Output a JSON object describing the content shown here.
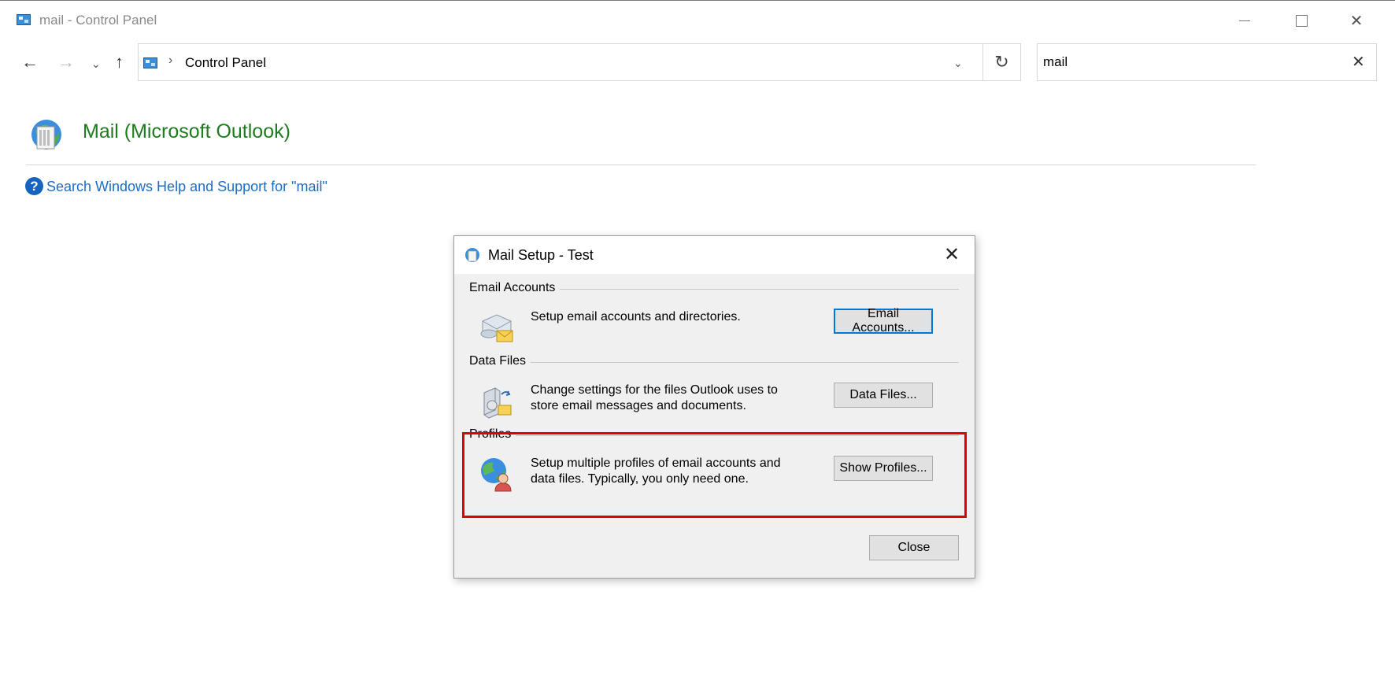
{
  "window": {
    "title": "mail - Control Panel",
    "min_icon": "minimize-icon",
    "max_icon": "maximize-icon",
    "close_icon": "close-icon",
    "close_glyph": "✕"
  },
  "nav": {
    "back_glyph": "←",
    "forward_glyph": "→",
    "recent_glyph": "⌄",
    "up_glyph": "↑",
    "separator": "›",
    "dropdown_glyph": "⌄",
    "refresh_glyph": "↻"
  },
  "address": {
    "breadcrumb": "Control Panel"
  },
  "search": {
    "value": "mail",
    "clear_glyph": "✕"
  },
  "result": {
    "title": "Mail (Microsoft Outlook)",
    "help_glyph": "?",
    "help_link": "Search Windows Help and Support for \"mail\""
  },
  "dialog": {
    "title": "Mail Setup - Test",
    "close_glyph": "✕",
    "sections": [
      {
        "label": "Email Accounts",
        "description_line1": "Setup email accounts and directories.",
        "description_line2": "",
        "button": "Email Accounts..."
      },
      {
        "label": "Data Files",
        "description_line1": "Change settings for the files Outlook uses to",
        "description_line2": "store email messages and documents.",
        "button": "Data Files..."
      },
      {
        "label": "Profiles",
        "description_line1": "Setup multiple profiles of email accounts and",
        "description_line2": "data files. Typically, you only need one.",
        "button": "Show Profiles..."
      }
    ],
    "close_button": "Close"
  },
  "colors": {
    "accent_green": "#1e7b1e",
    "link_blue": "#1a6ec8",
    "highlight_red": "#e00000",
    "default_button_border": "#0078d7"
  }
}
